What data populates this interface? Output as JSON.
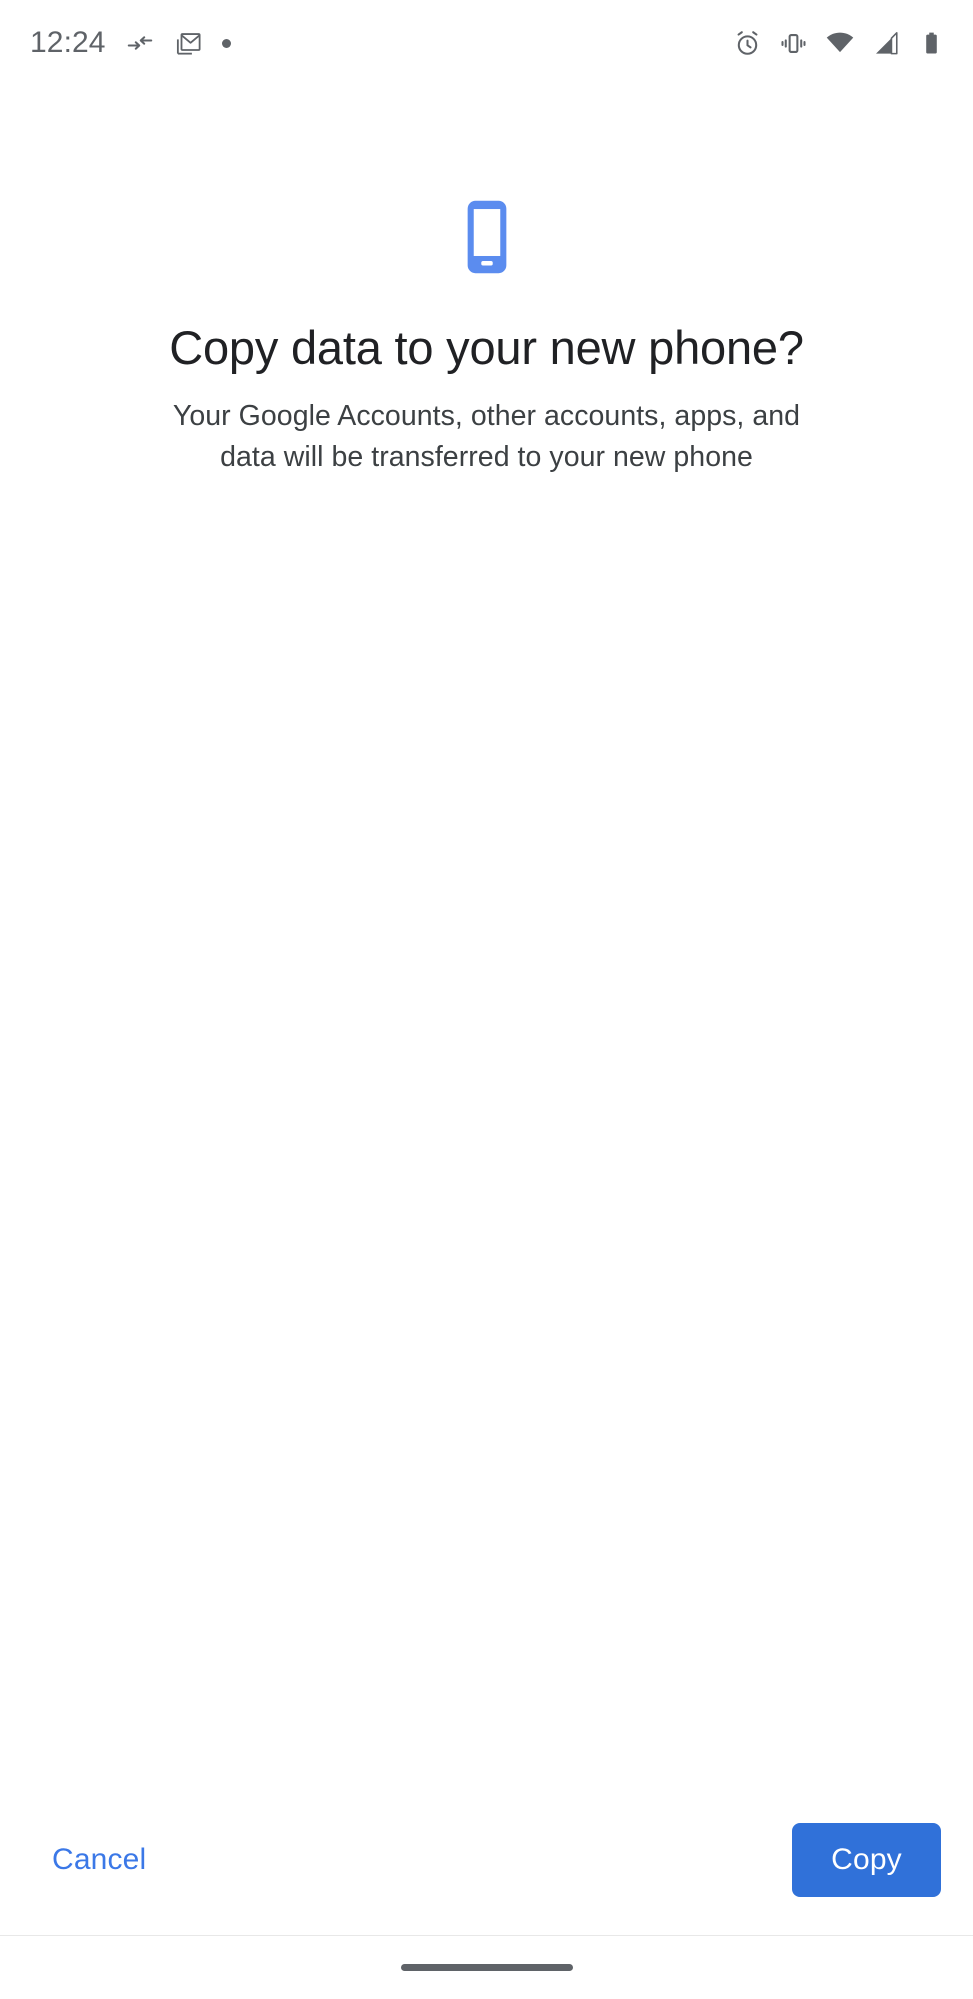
{
  "status_bar": {
    "clock": "12:24",
    "left_icons": [
      {
        "name": "data-transfer-icon",
        "label": "data transfer"
      },
      {
        "name": "gmail-icon",
        "label": "Gmail"
      },
      {
        "name": "notification-dot-icon",
        "label": "notification dot"
      }
    ],
    "right_icons": [
      {
        "name": "alarm-clock-icon",
        "label": "alarm set"
      },
      {
        "name": "vibrate-icon",
        "label": "ringer vibrate"
      },
      {
        "name": "wifi-icon",
        "label": "wifi full"
      },
      {
        "name": "cellular-signal-icon",
        "label": "cellular signal"
      },
      {
        "name": "battery-icon",
        "label": "battery full"
      }
    ]
  },
  "hero": {
    "icon": "smartphone-icon",
    "icon_color": "#5b8cef"
  },
  "main": {
    "title": "Copy data to your new phone?",
    "subtitle": "Your Google Accounts, other accounts, apps, and data will be transferred to your new phone"
  },
  "actions": {
    "cancel_label": "Cancel",
    "cancel_color": "#3b78e7",
    "copy_label": "Copy",
    "copy_bg": "#3071d9",
    "copy_color": "#ffffff"
  },
  "navigation": {
    "handle": "gesture-home-handle"
  },
  "colors": {
    "background": "#ffffff",
    "title_text": "#202124",
    "body_text": "#3c4043",
    "status_icon": "#5f6368",
    "accent_blue": "#3071d9"
  }
}
